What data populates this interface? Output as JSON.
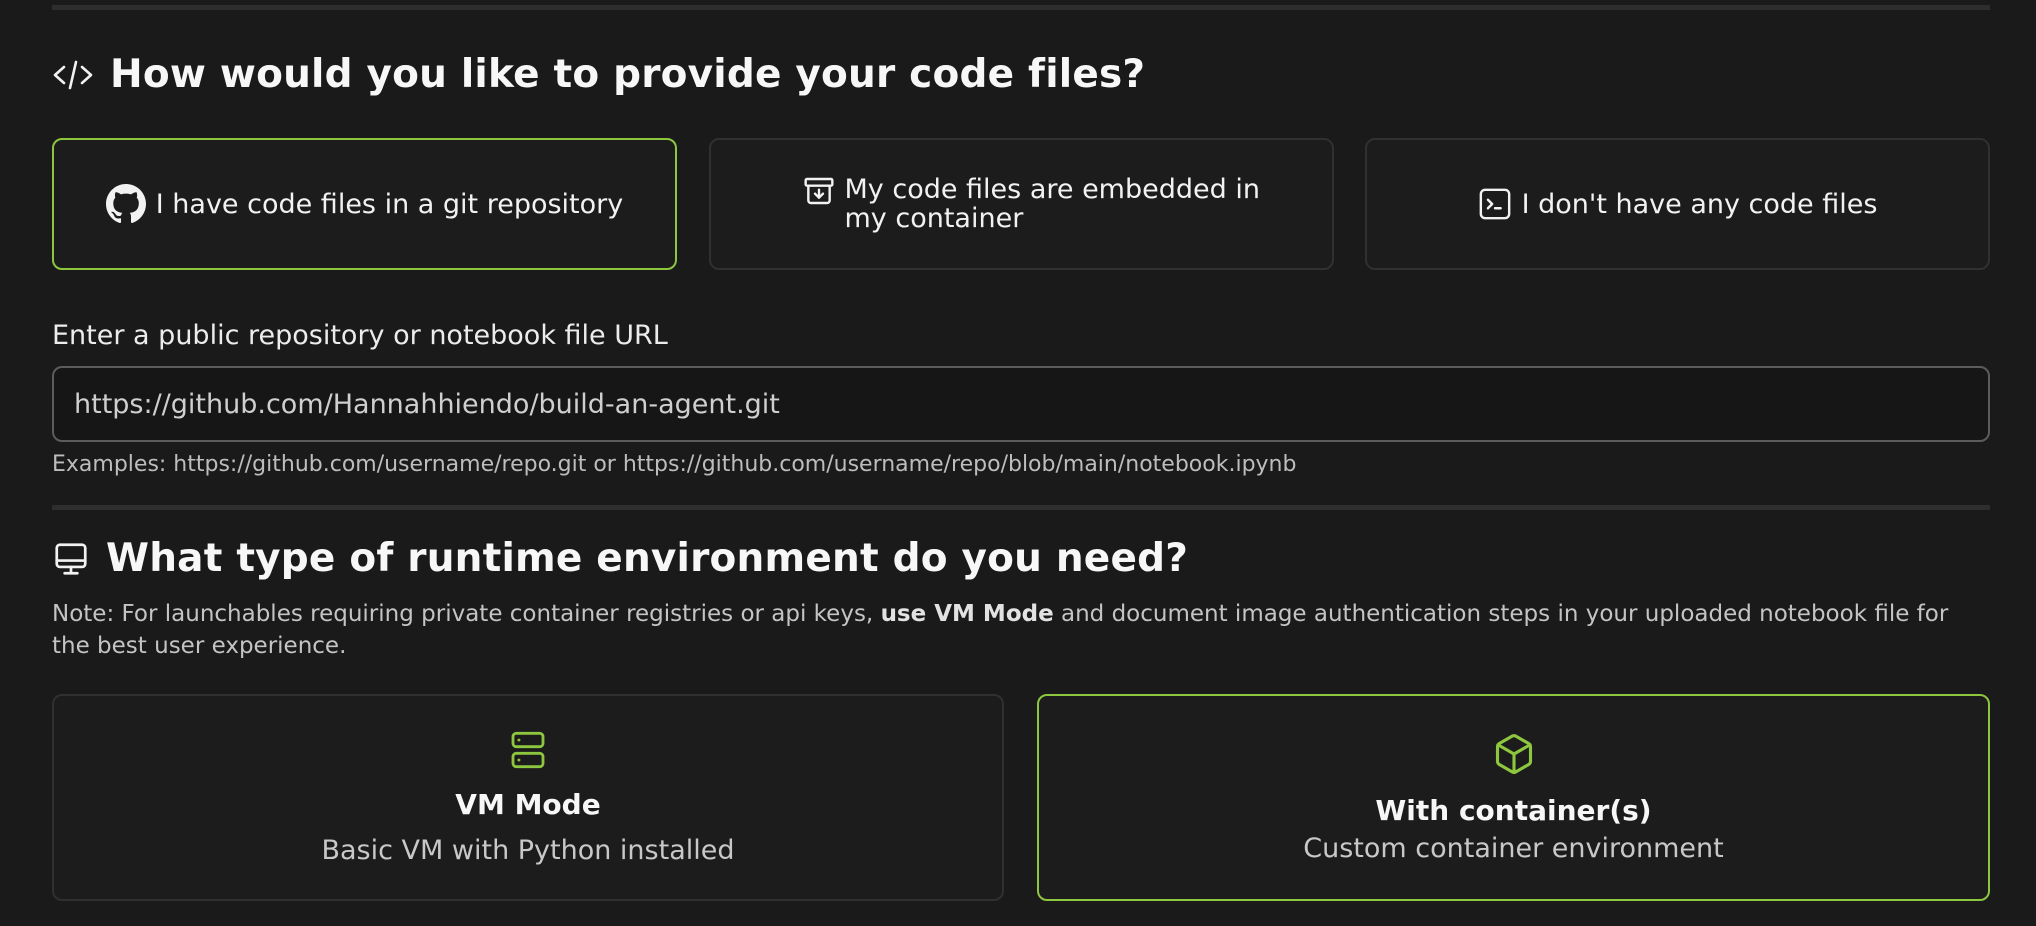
{
  "code_section": {
    "title": "How would you like to provide your code files?",
    "icon": "code-icon",
    "options": [
      {
        "label": "I have code files in a git repository",
        "icon": "github-icon",
        "selected": true
      },
      {
        "label": "My code files are embedded in my container",
        "icon": "archive-download-icon",
        "selected": false
      },
      {
        "label": "I don't have any code files",
        "icon": "terminal-icon",
        "selected": false
      }
    ]
  },
  "repo_url": {
    "label": "Enter a public repository or notebook file URL",
    "value": "https://github.com/Hannahhiendo/build-an-agent.git",
    "hint": "Examples: https://github.com/username/repo.git or https://github.com/username/repo/blob/main/notebook.ipynb"
  },
  "runtime_section": {
    "title": "What type of runtime environment do you need?",
    "icon": "monitor-icon",
    "note_before": "Note: For launchables requiring private container registries or api keys, ",
    "note_bold": "use VM Mode",
    "note_after": " and document image authentication steps in your uploaded notebook file for the best user experience.",
    "options": [
      {
        "title": "VM Mode",
        "subtitle": "Basic VM with Python installed",
        "icon": "server-icon",
        "selected": false
      },
      {
        "title": "With container(s)",
        "subtitle": "Custom container environment",
        "icon": "box-icon",
        "selected": true
      }
    ]
  },
  "colors": {
    "accent": "#8dc63f",
    "background": "#1a1a1a",
    "card_border": "#303030"
  }
}
